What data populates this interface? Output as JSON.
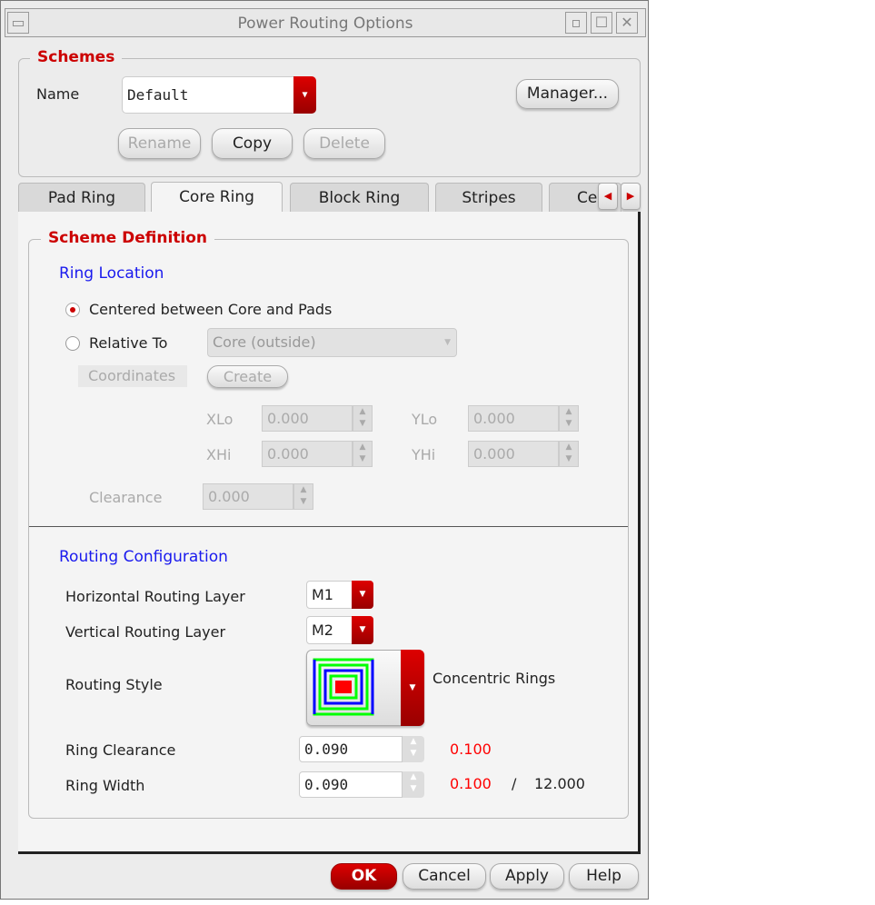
{
  "window": {
    "title": "Power Routing Options"
  },
  "schemes": {
    "legend": "Schemes",
    "name_label": "Name",
    "name_value": "Default",
    "manager": "Manager...",
    "rename": "Rename",
    "copy": "Copy",
    "delete": "Delete"
  },
  "tabs": [
    "Pad Ring",
    "Core Ring",
    "Block Ring",
    "Stripes",
    "Ce"
  ],
  "scheme_def": {
    "legend": "Scheme Definition",
    "ring_location": "Ring Location",
    "centered": "Centered between Core and Pads",
    "relative": "Relative To",
    "relative_value": "Core (outside)",
    "coordinates": "Coordinates",
    "create": "Create",
    "xlo": "XLo",
    "ylo": "YLo",
    "xhi": "XHi",
    "yhi": "YHi",
    "xlo_v": "0.000",
    "ylo_v": "0.000",
    "xhi_v": "0.000",
    "yhi_v": "0.000",
    "clearance": "Clearance",
    "clearance_v": "0.000"
  },
  "routing": {
    "title": "Routing Configuration",
    "h_label": "Horizontal Routing Layer",
    "h_value": "M1",
    "v_label": "Vertical Routing Layer",
    "v_value": "M2",
    "style_label": "Routing Style",
    "style_value": "Concentric Rings",
    "rc_label": "Ring Clearance",
    "rc_value": "0.090",
    "rc_min": "0.100",
    "rw_label": "Ring Width",
    "rw_value": "0.090",
    "rw_min": "0.100",
    "rw_sep": "/",
    "rw_max": "12.000"
  },
  "buttons": {
    "ok": "OK",
    "cancel": "Cancel",
    "apply": "Apply",
    "help": "Help"
  },
  "colors": {
    "accent": "#cc0000",
    "link": "#1a1aee"
  }
}
